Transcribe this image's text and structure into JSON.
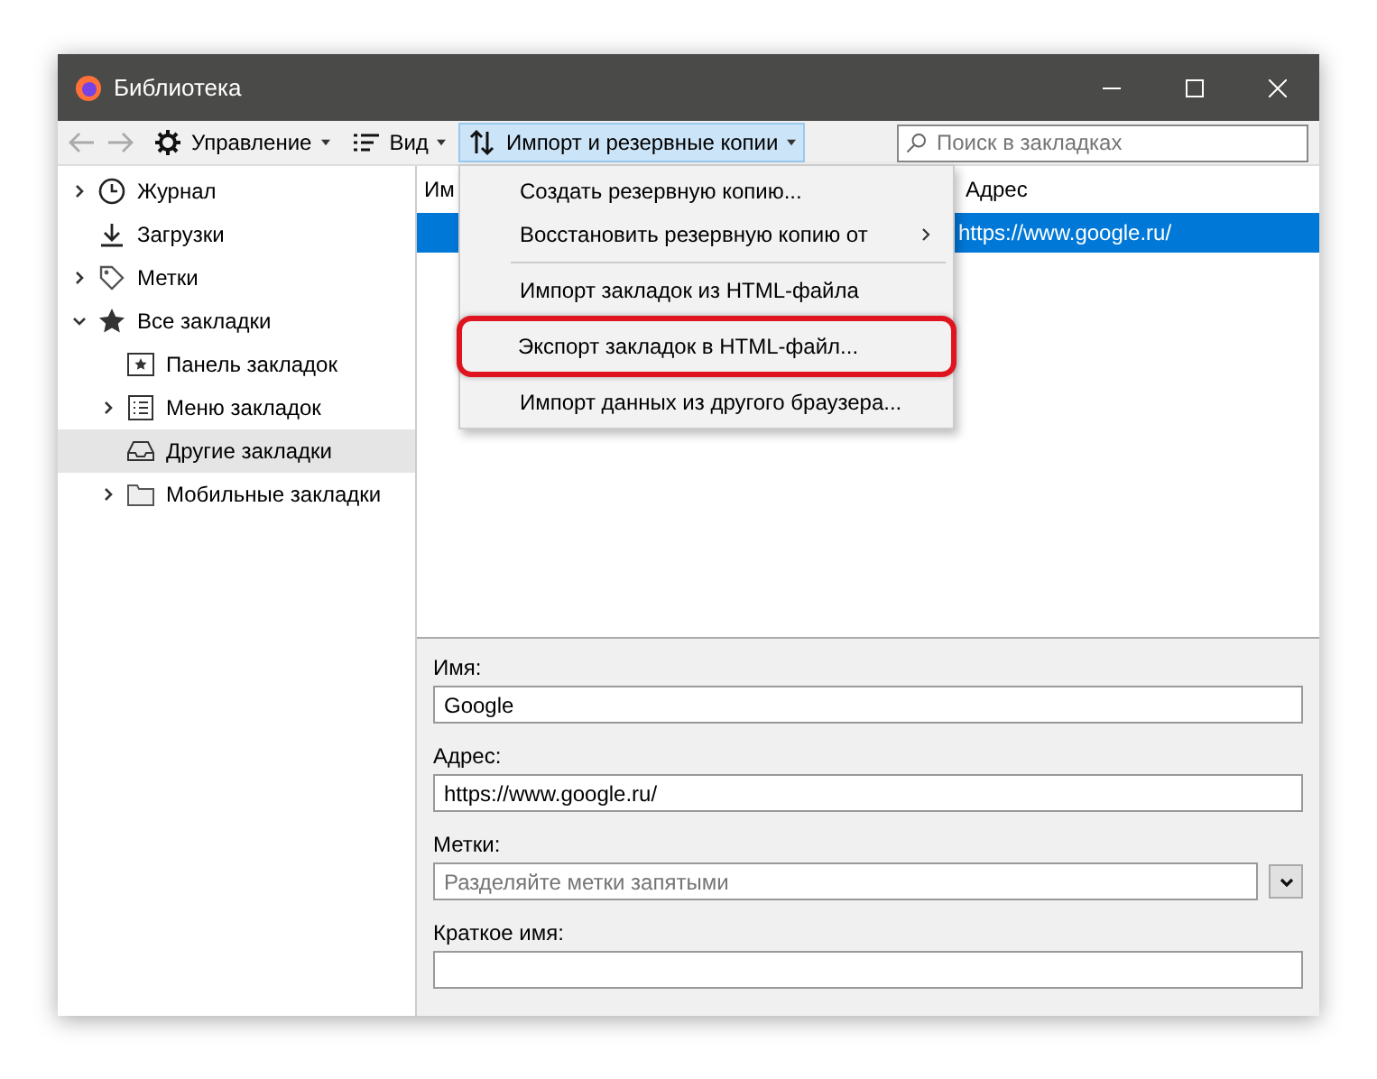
{
  "window": {
    "title": "Библиотека"
  },
  "toolbar": {
    "buttons": [
      {
        "label": "Управление",
        "kind": "gear",
        "selected": false
      },
      {
        "label": "Вид",
        "kind": "list",
        "selected": false
      },
      {
        "label": "Импорт и резервные копии",
        "kind": "arrows",
        "selected": true
      }
    ],
    "search": {
      "placeholder": "Поиск в закладках"
    }
  },
  "sidebar": {
    "items": [
      {
        "label": "Журнал",
        "kind": "clock",
        "expanded": false,
        "selected": false
      },
      {
        "label": "Загрузки",
        "kind": "download",
        "selected": false
      },
      {
        "label": "Метки",
        "kind": "tag",
        "expanded": false,
        "selected": false
      },
      {
        "label": "Все закладки",
        "kind": "star",
        "expanded": true,
        "selected": false,
        "children": [
          {
            "label": "Панель закладок",
            "kind": "toolbar",
            "selected": false
          },
          {
            "label": "Меню закладок",
            "kind": "menu",
            "expanded": false,
            "selected": false
          },
          {
            "label": "Другие закладки",
            "kind": "tray",
            "selected": true
          },
          {
            "label": "Мобильные закладки",
            "kind": "folder",
            "expanded": false,
            "selected": false
          }
        ]
      }
    ]
  },
  "table": {
    "columns": [
      "Им",
      "Адрес"
    ],
    "rows": [
      {
        "address": "https://www.google.ru/",
        "selected": true
      }
    ]
  },
  "menu": {
    "items": [
      {
        "kind": "item",
        "label": "Создать резервную копию...",
        "submenu": false,
        "annotated": false
      },
      {
        "kind": "item",
        "label": "Восстановить резервную копию от",
        "submenu": true,
        "annotated": false
      },
      {
        "kind": "separator"
      },
      {
        "kind": "item",
        "label": "Импорт закладок из HTML-файла",
        "submenu": false,
        "annotated": false
      },
      {
        "kind": "item",
        "label": "Экспорт закладок в HTML-файл...",
        "submenu": false,
        "annotated": true
      },
      {
        "kind": "item",
        "label": "Импорт данных из другого браузера...",
        "submenu": false,
        "annotated": false
      }
    ]
  },
  "details": {
    "fields": [
      {
        "kind": "text",
        "label": "Имя:",
        "value": "Google"
      },
      {
        "kind": "text",
        "label": "Адрес:",
        "value": "https://www.google.ru/"
      },
      {
        "kind": "dropdown",
        "label": "Метки:",
        "placeholder": "Разделяйте метки запятыми"
      },
      {
        "kind": "text",
        "label": "Краткое имя:"
      }
    ]
  }
}
